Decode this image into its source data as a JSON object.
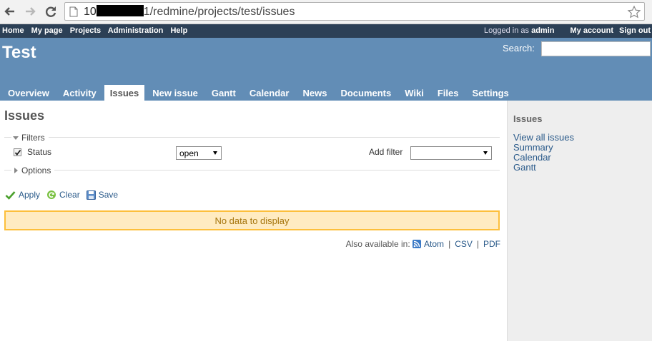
{
  "browser": {
    "url_prefix": "10",
    "url_suffix": "1/redmine/projects/test/issues"
  },
  "top_menu": {
    "left_items": [
      {
        "label": "Home"
      },
      {
        "label": "My page"
      },
      {
        "label": "Projects"
      },
      {
        "label": "Administration"
      },
      {
        "label": "Help"
      }
    ],
    "logged_in_as": "Logged in as",
    "user": "admin",
    "my_account": "My account",
    "sign_out": "Sign out"
  },
  "header": {
    "project_title": "Test",
    "search_label": "Search:",
    "search_value": ""
  },
  "main_menu": {
    "tabs": [
      {
        "label": "Overview",
        "selected": false
      },
      {
        "label": "Activity",
        "selected": false
      },
      {
        "label": "Issues",
        "selected": true
      },
      {
        "label": "New issue",
        "selected": false
      },
      {
        "label": "Gantt",
        "selected": false
      },
      {
        "label": "Calendar",
        "selected": false
      },
      {
        "label": "News",
        "selected": false
      },
      {
        "label": "Documents",
        "selected": false
      },
      {
        "label": "Wiki",
        "selected": false
      },
      {
        "label": "Files",
        "selected": false
      },
      {
        "label": "Settings",
        "selected": false
      }
    ]
  },
  "content": {
    "title": "Issues",
    "filters_label": "Filters",
    "status_label": "Status",
    "status_checked": true,
    "status_value": "open",
    "add_filter_label": "Add filter",
    "add_filter_value": "",
    "options_label": "Options",
    "apply_label": "Apply",
    "clear_label": "Clear",
    "save_label": "Save",
    "nodata": "No data to display",
    "also_available": "Also available in:",
    "formats": [
      "Atom",
      "CSV",
      "PDF"
    ]
  },
  "sidebar": {
    "title": "Issues",
    "links": [
      "View all issues",
      "Summary",
      "Calendar",
      "Gantt"
    ]
  },
  "colors": {
    "top_menu_bg": "#2c4056",
    "header_bg": "#628db6",
    "link": "#2a5a8a",
    "nodata_bg": "#ffebc1",
    "nodata_border": "#fdbf3b",
    "sidebar_bg": "#eeeeee"
  },
  "icons": {
    "back": "arrow-left-icon",
    "forward": "arrow-right-icon",
    "reload": "reload-icon",
    "page": "page-icon",
    "star": "star-icon",
    "apply": "checkmark-icon",
    "clear": "reload-icon",
    "save": "floppy-icon",
    "atom": "feed-icon"
  }
}
